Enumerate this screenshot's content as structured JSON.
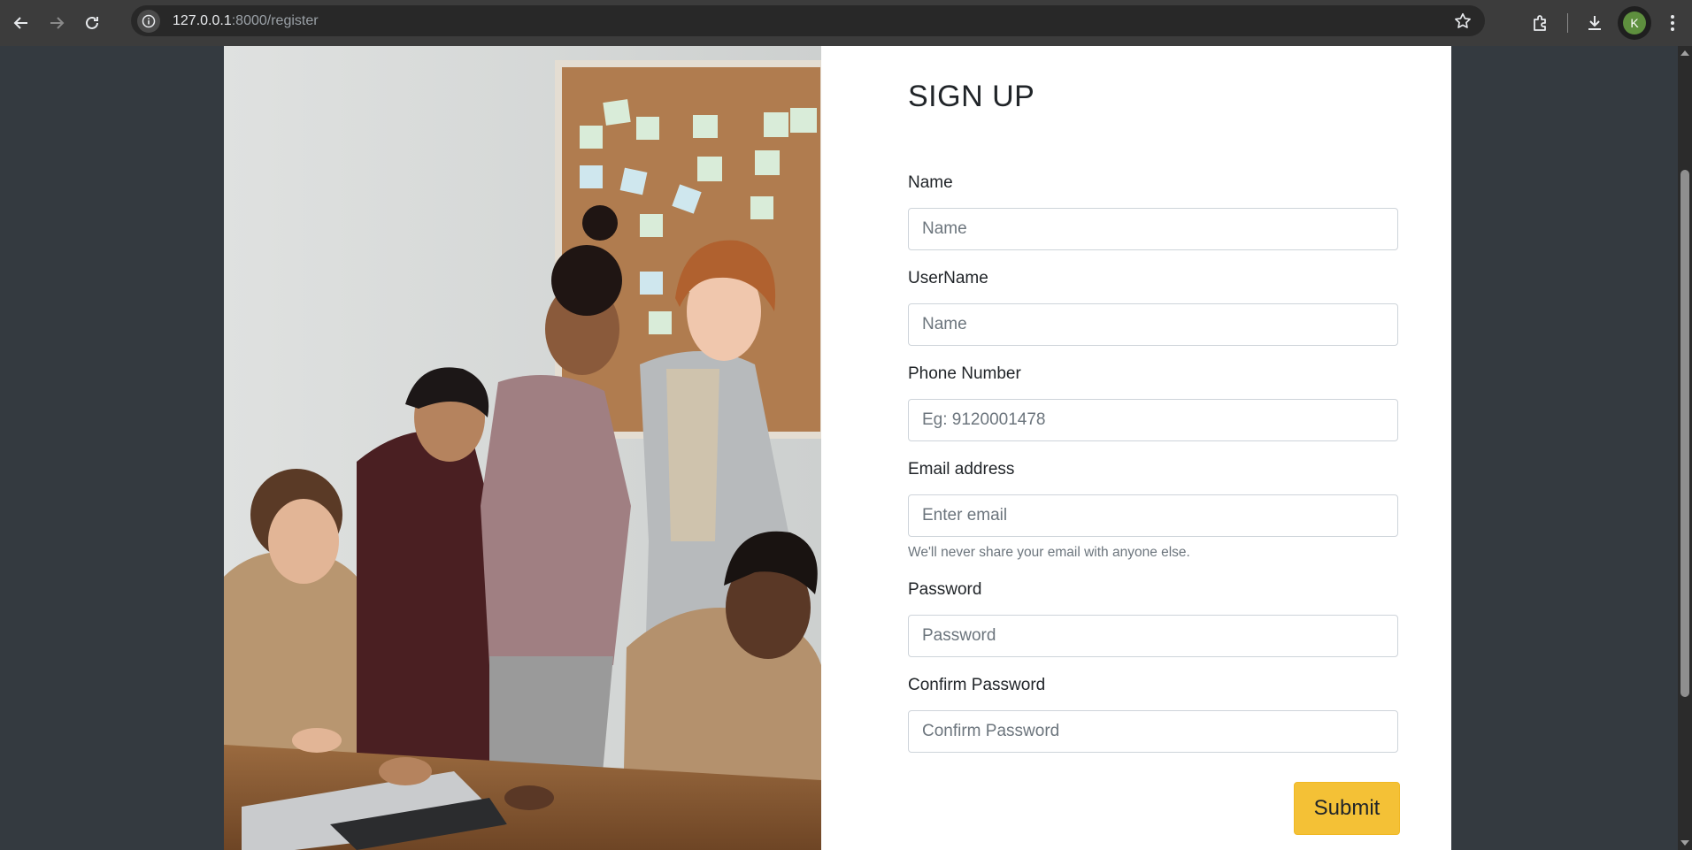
{
  "browser": {
    "url_host": "127.0.0.1",
    "url_rest": ":8000/register",
    "avatar_letter": "K",
    "icons": [
      "back-icon",
      "forward-icon",
      "reload-icon",
      "info-icon",
      "star-icon",
      "extensions-icon",
      "download-icon",
      "menu-icon"
    ]
  },
  "form": {
    "title": "SIGN UP",
    "fields": [
      {
        "label": "Name",
        "placeholder": "Name",
        "type": "text"
      },
      {
        "label": "UserName",
        "placeholder": "Name",
        "type": "text"
      },
      {
        "label": "Phone Number",
        "placeholder": "Eg: 9120001478",
        "type": "tel"
      },
      {
        "label": "Email address",
        "placeholder": "Enter email",
        "type": "email",
        "help": "We'll never share your email with anyone else."
      },
      {
        "label": "Password",
        "placeholder": "Password",
        "type": "password"
      },
      {
        "label": "Confirm Password",
        "placeholder": "Confirm Password",
        "type": "password"
      }
    ],
    "submit_label": "Submit"
  },
  "colors": {
    "page_background": "#343a40",
    "card_background": "#ffffff",
    "submit_background": "#f4c136",
    "text": "#212529",
    "muted_text": "#6c757d"
  }
}
